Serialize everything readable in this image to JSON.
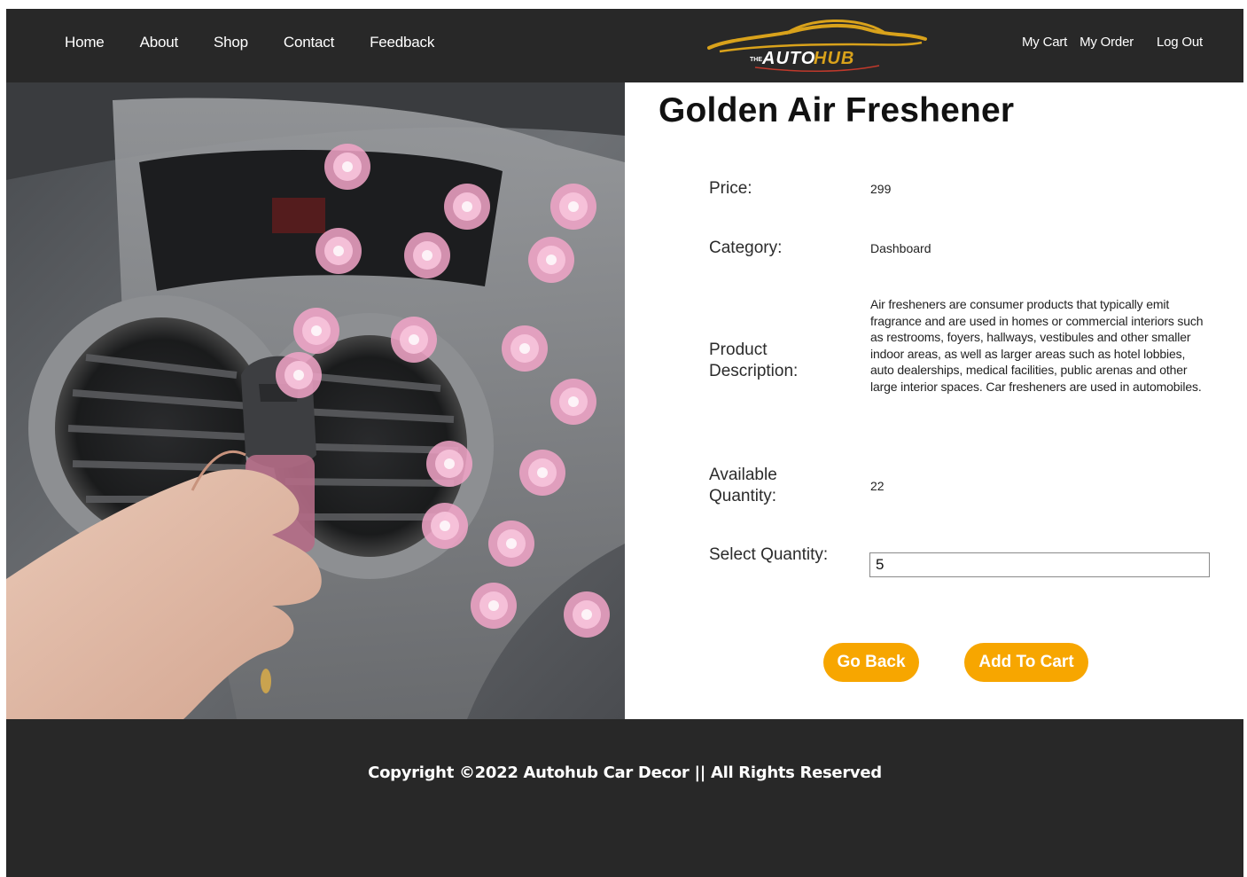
{
  "nav": {
    "home": "Home",
    "about": "About",
    "shop": "Shop",
    "contact": "Contact",
    "feedback": "Feedback",
    "my_cart": "My Cart",
    "my_order": "My Order",
    "log_out": "Log Out"
  },
  "logo": {
    "small_text": "THE",
    "auto": "AUTO",
    "hub": "HUB",
    "gold": "#d9a21b",
    "red": "#c0392b"
  },
  "product": {
    "title": "Golden Air Freshener",
    "price_label": "Price:",
    "price_value": "299",
    "category_label": "Category:",
    "category_value": "Dashboard",
    "description_label": "Product Description:",
    "description_value": "Air fresheners are consumer products that typically emit fragrance and are used in homes or commercial interiors such as restrooms, foyers, hallways, vestibules and other smaller indoor areas, as well as larger areas such as hotel lobbies, auto dealerships, medical facilities, public arenas and other large interior spaces. Car fresheners are used in automobiles.",
    "available_label": "Available Quantity:",
    "available_value": "22",
    "select_label": "Select Quantity:",
    "select_value": "5"
  },
  "buttons": {
    "go_back": "Go Back",
    "add_to_cart": "Add To Cart"
  },
  "footer": {
    "copyright": "Copyright ©2022 Autohub Car Decor || All Rights Reserved"
  },
  "colors": {
    "navbar_bg": "#282828",
    "accent": "#f7a600",
    "flower_pink": "#f2a5c8"
  }
}
